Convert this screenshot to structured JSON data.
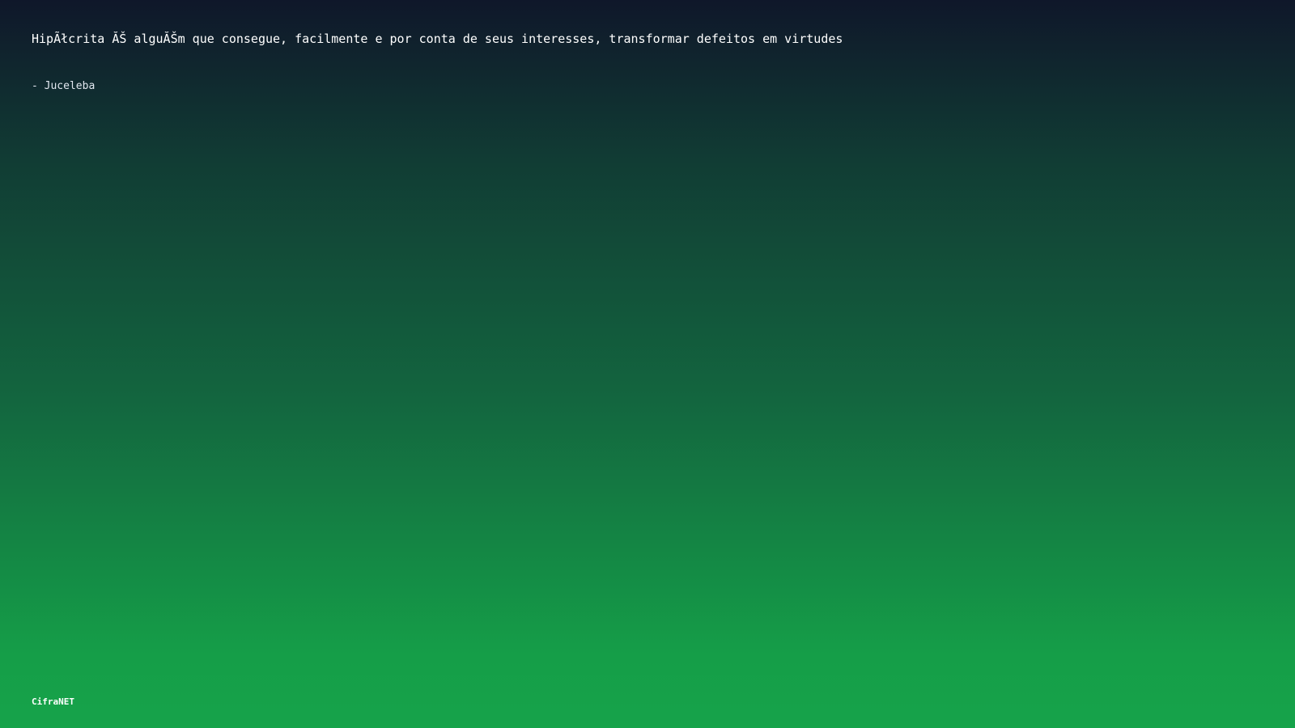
{
  "quote": {
    "text": "HipÃłcrita ĂŠ alguĂŠm que consegue, facilmente e por conta de seus interesses, transformar defeitos em virtudes",
    "author_line": "- Juceleba"
  },
  "brand": {
    "name": "CifraNET"
  },
  "colors": {
    "background_top": "#0f172a",
    "background_bottom": "#16a34a",
    "text": "#ffffff"
  }
}
